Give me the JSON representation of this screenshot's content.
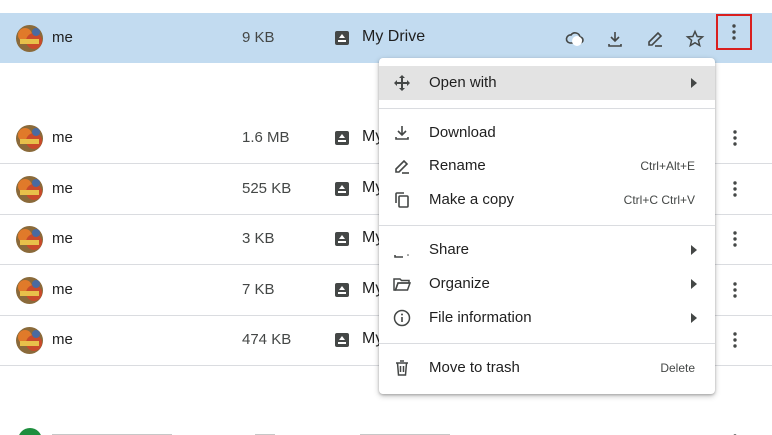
{
  "files": [
    {
      "owner": "me",
      "size": "9 KB",
      "location": "My Drive"
    },
    {
      "owner": "me",
      "size": "1.6 MB",
      "location": "My"
    },
    {
      "owner": "me",
      "size": "525 KB",
      "location": "My"
    },
    {
      "owner": "me",
      "size": "3 KB",
      "location": "My"
    },
    {
      "owner": "me",
      "size": "7 KB",
      "location": "My"
    },
    {
      "owner": "me",
      "size": "474 KB",
      "location": "My"
    }
  ],
  "menu": {
    "open_with": "Open with",
    "download": "Download",
    "rename": "Rename",
    "rename_shortcut": "Ctrl+Alt+E",
    "make_copy": "Make a copy",
    "make_copy_shortcut": "Ctrl+C Ctrl+V",
    "share": "Share",
    "organize": "Organize",
    "file_information": "File information",
    "move_to_trash": "Move to trash",
    "move_to_trash_shortcut": "Delete"
  },
  "colors": {
    "selected_row": "#c2dbf0",
    "highlight_box": "#d91f1f",
    "menu_hover": "#e3e3e3"
  }
}
